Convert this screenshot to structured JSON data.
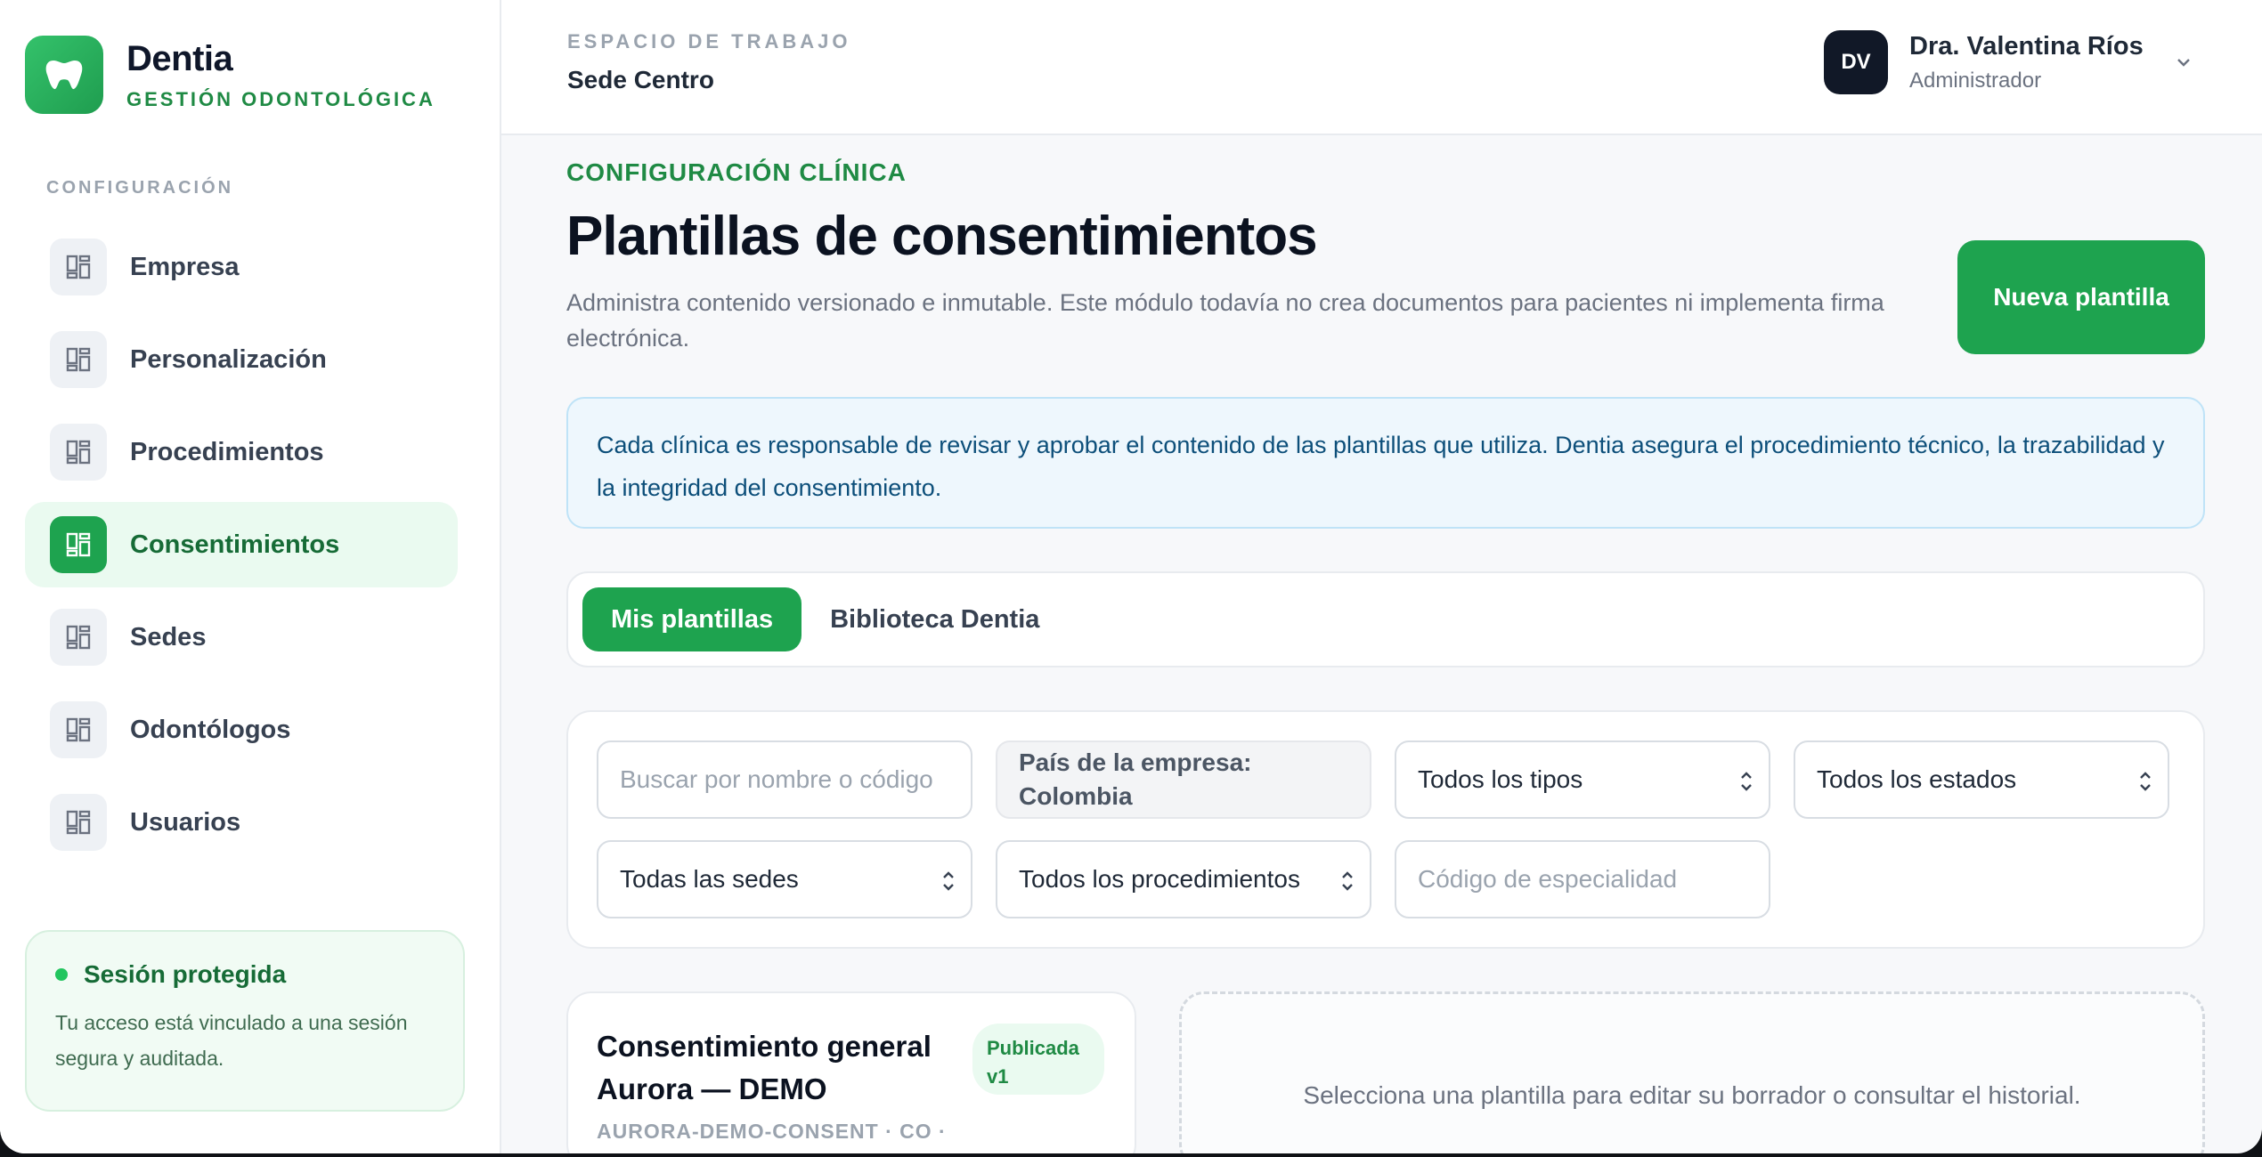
{
  "brand": {
    "name": "Dentia",
    "tagline": "GESTIÓN ODONTOLÓGICA"
  },
  "sidebar": {
    "section_label": "CONFIGURACIÓN",
    "items": [
      {
        "label": "Empresa",
        "icon": "dashboard-icon",
        "active": false
      },
      {
        "label": "Personalización",
        "icon": "dashboard-icon",
        "active": false
      },
      {
        "label": "Procedimientos",
        "icon": "dashboard-icon",
        "active": false
      },
      {
        "label": "Consentimientos",
        "icon": "dashboard-icon",
        "active": true
      },
      {
        "label": "Sedes",
        "icon": "dashboard-icon",
        "active": false
      },
      {
        "label": "Odontólogos",
        "icon": "dashboard-icon",
        "active": false
      },
      {
        "label": "Usuarios",
        "icon": "dashboard-icon",
        "active": false
      }
    ],
    "session": {
      "title": "Sesión protegida",
      "description": "Tu acceso está vinculado a una sesión segura y auditada."
    }
  },
  "header": {
    "workspace_label": "ESPACIO DE TRABAJO",
    "workspace_value": "Sede Centro",
    "user": {
      "initials": "DV",
      "name": "Dra. Valentina Ríos",
      "role": "Administrador"
    }
  },
  "main": {
    "eyebrow": "CONFIGURACIÓN CLÍNICA",
    "title": "Plantillas de consentimientos",
    "description": "Administra contenido versionado e inmutable. Este módulo todavía no crea documentos para pacientes ni implementa firma electrónica.",
    "new_button": "Nueva plantilla",
    "notice": "Cada clínica es responsable de revisar y aprobar el contenido de las plantillas que utiliza. Dentia asegura el procedimiento técnico, la trazabilidad y la integridad del consentimiento.",
    "tabs": [
      {
        "label": "Mis plantillas",
        "active": true
      },
      {
        "label": "Biblioteca Dentia",
        "active": false
      }
    ],
    "filters": {
      "search_placeholder": "Buscar por nombre o código",
      "country": "País de la empresa: Colombia",
      "type": "Todos los tipos",
      "status": "Todos los estados",
      "site": "Todas las sedes",
      "procedure": "Todos los procedimientos",
      "specialty_placeholder": "Código de especialidad"
    },
    "template_card": {
      "title": "Consentimiento general Aurora — DEMO",
      "badge": "Publicada v1",
      "code": "AURORA-DEMO-CONSENT · CO ·"
    },
    "empty_state": "Selecciona una plantilla para editar su borrador o consultar el historial."
  },
  "colors": {
    "accent": "#1ea34f",
    "accent_dark": "#1f8a44",
    "notice_bg": "#eef7fd",
    "notice_text": "#0d4f7a"
  }
}
